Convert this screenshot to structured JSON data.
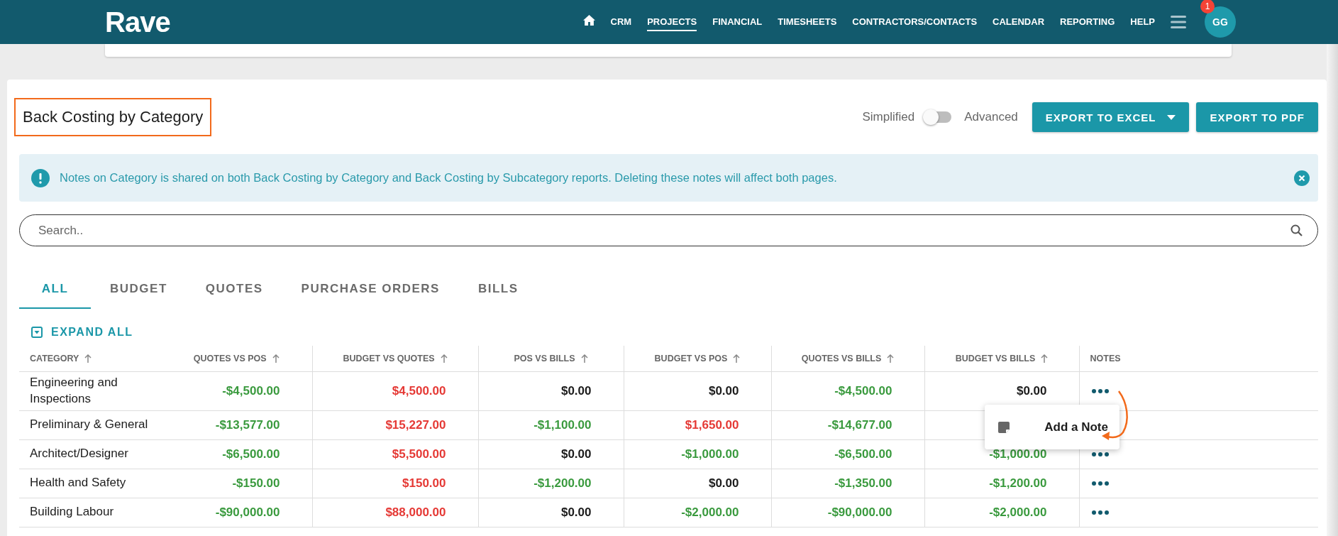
{
  "header": {
    "logo": "Rave",
    "nav": [
      {
        "kind": "home",
        "selected": false
      },
      {
        "kind": "text",
        "label": "CRM",
        "selected": false
      },
      {
        "kind": "text",
        "label": "PROJECTS",
        "selected": true
      },
      {
        "kind": "text",
        "label": "FINANCIAL",
        "selected": false
      },
      {
        "kind": "text",
        "label": "TIMESHEETS",
        "selected": false
      },
      {
        "kind": "text",
        "label": "CONTRACTORS/CONTACTS",
        "selected": false
      },
      {
        "kind": "text",
        "label": "CALENDAR",
        "selected": false
      },
      {
        "kind": "text",
        "label": "REPORTING",
        "selected": false
      },
      {
        "kind": "text",
        "label": "HELP",
        "selected": false
      }
    ],
    "avatar": {
      "initials": "GG",
      "badge": "1"
    }
  },
  "report": {
    "title": "Back Costing by Category",
    "view_toggle": {
      "left_label": "Simplified",
      "right_label": "Advanced",
      "on": false
    },
    "buttons": [
      {
        "label": "EXPORT TO EXCEL",
        "dropdown": true
      },
      {
        "label": "EXPORT TO PDF",
        "dropdown": false
      }
    ]
  },
  "alert": {
    "message": "Notes on Category is shared on both Back Costing by Category and Back Costing by Subcategory reports. Deleting these notes will affect both pages."
  },
  "search": {
    "placeholder": "Search.."
  },
  "tabs": [
    {
      "label": "ALL",
      "selected": true
    },
    {
      "label": "BUDGET",
      "selected": false
    },
    {
      "label": "QUOTES",
      "selected": false
    },
    {
      "label": "PURCHASE ORDERS",
      "selected": false
    },
    {
      "label": "BILLS",
      "selected": false
    }
  ],
  "expand_all": "EXPAND ALL",
  "table": {
    "columns": [
      {
        "label": "CATEGORY",
        "sortable": true
      },
      {
        "label": "QUOTES VS POS",
        "sortable": true
      },
      {
        "label": "BUDGET VS QUOTES",
        "sortable": true
      },
      {
        "label": "POS VS BILLS",
        "sortable": true
      },
      {
        "label": "BUDGET VS POS",
        "sortable": true
      },
      {
        "label": "QUOTES VS BILLS",
        "sortable": true
      },
      {
        "label": "BUDGET VS BILLS",
        "sortable": true
      },
      {
        "label": "NOTES",
        "sortable": false
      }
    ],
    "rows": [
      {
        "cells": [
          {
            "value": "Engineering and Inspections"
          },
          {
            "value": "-$4,500.00",
            "color": "#3a9a3e"
          },
          {
            "value": "$4,500.00",
            "color": "#e53935"
          },
          {
            "value": "$0.00",
            "color": "#1c1c1c"
          },
          {
            "value": "$0.00",
            "color": "#1c1c1c"
          },
          {
            "value": "-$4,500.00",
            "color": "#3a9a3e"
          },
          {
            "value": "$0.00",
            "color": "#1c1c1c"
          }
        ],
        "notes_menu": true
      },
      {
        "cells": [
          {
            "value": "Preliminary & General"
          },
          {
            "value": "-$13,577.00",
            "color": "#3a9a3e"
          },
          {
            "value": "$15,227.00",
            "color": "#e53935"
          },
          {
            "value": "-$1,100.00",
            "color": "#3a9a3e"
          },
          {
            "value": "$1,650.00",
            "color": "#e53935"
          },
          {
            "value": "-$14,677.00",
            "color": "#3a9a3e"
          }
        ],
        "notes_menu": false
      },
      {
        "cells": [
          {
            "value": "Architect/Designer"
          },
          {
            "value": "-$6,500.00",
            "color": "#3a9a3e"
          },
          {
            "value": "$5,500.00",
            "color": "#e53935"
          },
          {
            "value": "$0.00",
            "color": "#1c1c1c"
          },
          {
            "value": "-$1,000.00",
            "color": "#3a9a3e"
          },
          {
            "value": "-$6,500.00",
            "color": "#3a9a3e"
          },
          {
            "value": "-$1,000.00",
            "color": "#3a9a3e"
          }
        ],
        "notes_menu": true
      },
      {
        "cells": [
          {
            "value": "Health and Safety"
          },
          {
            "value": "-$150.00",
            "color": "#3a9a3e"
          },
          {
            "value": "$150.00",
            "color": "#e53935"
          },
          {
            "value": "-$1,200.00",
            "color": "#3a9a3e"
          },
          {
            "value": "$0.00",
            "color": "#1c1c1c"
          },
          {
            "value": "-$1,350.00",
            "color": "#3a9a3e"
          },
          {
            "value": "-$1,200.00",
            "color": "#3a9a3e"
          }
        ],
        "notes_menu": true
      },
      {
        "cells": [
          {
            "value": "Building Labour"
          },
          {
            "value": "-$90,000.00",
            "color": "#3a9a3e"
          },
          {
            "value": "$88,000.00",
            "color": "#e53935"
          },
          {
            "value": "$0.00",
            "color": "#1c1c1c"
          },
          {
            "value": "-$2,000.00",
            "color": "#3a9a3e"
          },
          {
            "value": "-$90,000.00",
            "color": "#3a9a3e"
          },
          {
            "value": "-$2,000.00",
            "color": "#3a9a3e"
          }
        ],
        "notes_menu": true
      }
    ]
  },
  "context_menu": {
    "items": [
      {
        "label": "Add a Note"
      }
    ]
  }
}
